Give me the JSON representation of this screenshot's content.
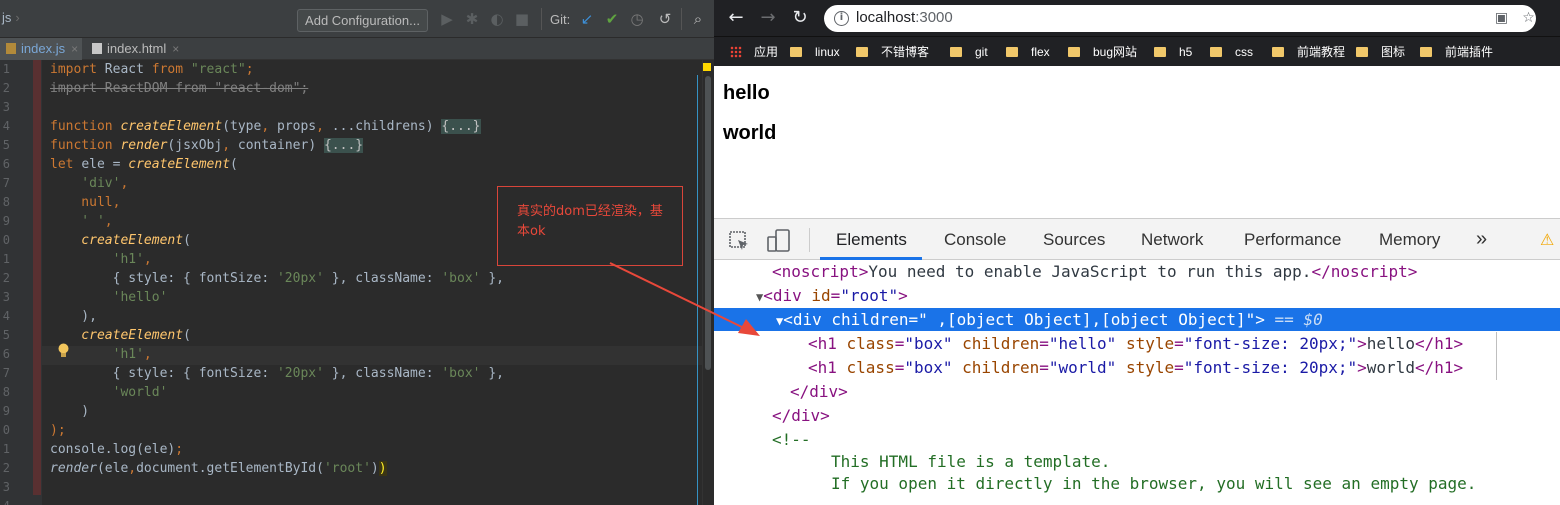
{
  "ide": {
    "breadcrumb": "js",
    "toolbar": {
      "add_configuration": "Add Configuration...",
      "git_label": "Git:"
    },
    "tabs": [
      {
        "label": "index.js",
        "active": true
      },
      {
        "label": "index.html",
        "active": false
      }
    ],
    "line_numbers": [
      "1",
      "2",
      "3",
      "4",
      "5",
      "6",
      "7",
      "8",
      "9",
      "0",
      "1",
      "2",
      "3",
      "4",
      "5",
      "6",
      "7",
      "8",
      "9",
      "0",
      "1",
      "2",
      "3",
      "4"
    ],
    "code_lines": [
      [
        {
          "t": "import ",
          "c": "kw"
        },
        {
          "t": "React ",
          "c": ""
        },
        {
          "t": "from ",
          "c": "kw"
        },
        {
          "t": "\"react\"",
          "c": "str"
        },
        {
          "t": ";",
          "c": "kw"
        }
      ],
      [
        {
          "t": "import ReactDOM from \"react-dom\";",
          "c": "dim"
        }
      ],
      [],
      [
        {
          "t": "function ",
          "c": "kw"
        },
        {
          "t": "createElement",
          "c": "fn"
        },
        {
          "t": "(type",
          "c": ""
        },
        {
          "t": ", ",
          "c": "kw"
        },
        {
          "t": "props",
          "c": ""
        },
        {
          "t": ", ",
          "c": "kw"
        },
        {
          "t": "...childrens) ",
          "c": ""
        },
        {
          "t": "{...}",
          "c": "fold"
        }
      ],
      [
        {
          "t": "function ",
          "c": "kw"
        },
        {
          "t": "render",
          "c": "fn"
        },
        {
          "t": "(jsxObj",
          "c": ""
        },
        {
          "t": ", ",
          "c": "kw"
        },
        {
          "t": "container) ",
          "c": ""
        },
        {
          "t": "{...}",
          "c": "fold"
        }
      ],
      [
        {
          "t": "let ",
          "c": "kw"
        },
        {
          "t": "ele = ",
          "c": ""
        },
        {
          "t": "createElement",
          "c": "fn"
        },
        {
          "t": "(",
          "c": ""
        }
      ],
      [
        {
          "t": "    'div'",
          "c": "str"
        },
        {
          "t": ",",
          "c": "kw"
        }
      ],
      [
        {
          "t": "    null",
          "c": "kw"
        },
        {
          "t": ",",
          "c": "kw"
        }
      ],
      [
        {
          "t": "    ' '",
          "c": "str"
        },
        {
          "t": ",",
          "c": "kw"
        }
      ],
      [
        {
          "t": "    createElement",
          "c": "fn"
        },
        {
          "t": "(",
          "c": ""
        }
      ],
      [
        {
          "t": "        'h1'",
          "c": "str"
        },
        {
          "t": ",",
          "c": "kw"
        }
      ],
      [
        {
          "t": "        { style: { fontSize: ",
          "c": ""
        },
        {
          "t": "'20px'",
          "c": "str"
        },
        {
          "t": " }, className: ",
          "c": ""
        },
        {
          "t": "'box'",
          "c": "str"
        },
        {
          "t": " },",
          "c": ""
        }
      ],
      [
        {
          "t": "        'hello'",
          "c": "str"
        }
      ],
      [
        {
          "t": "    ),",
          "c": ""
        }
      ],
      [
        {
          "t": "    createElement",
          "c": "fn"
        },
        {
          "t": "(",
          "c": ""
        }
      ],
      [
        {
          "t": "        'h1'",
          "c": "str"
        },
        {
          "t": ",",
          "c": "kw"
        }
      ],
      [
        {
          "t": "        { style: { fontSize: ",
          "c": ""
        },
        {
          "t": "'20px'",
          "c": "str"
        },
        {
          "t": " }, className: ",
          "c": ""
        },
        {
          "t": "'box'",
          "c": "str"
        },
        {
          "t": " },",
          "c": ""
        }
      ],
      [
        {
          "t": "        'world'",
          "c": "str"
        }
      ],
      [
        {
          "t": "    )",
          "c": ""
        }
      ],
      [
        {
          "t": ");",
          "c": "kw"
        }
      ],
      [
        {
          "t": "console.log(ele)",
          "c": ""
        },
        {
          "t": ";",
          "c": "kw"
        }
      ],
      [
        {
          "t": "render",
          "c": "fni"
        },
        {
          "t": "(ele",
          "c": ""
        },
        {
          "t": ",",
          "c": "kw"
        },
        {
          "t": "document.getElementById(",
          "c": ""
        },
        {
          "t": "'root'",
          "c": "str"
        },
        {
          "t": ")",
          "c": ""
        },
        {
          "t": ")",
          "c": "brk"
        }
      ],
      [],
      []
    ],
    "annotation": "真实的dom已经渲染，基本ok"
  },
  "browser": {
    "url_host": "localhost",
    "url_port": ":3000",
    "bookmarks": [
      {
        "label": "应用",
        "kind": "apps"
      },
      {
        "label": "linux",
        "kind": "folder"
      },
      {
        "label": "不错博客",
        "kind": "folder"
      },
      {
        "label": "git",
        "kind": "folder"
      },
      {
        "label": "flex",
        "kind": "folder"
      },
      {
        "label": "bug网站",
        "kind": "folder"
      },
      {
        "label": "h5",
        "kind": "folder"
      },
      {
        "label": "css",
        "kind": "folder"
      },
      {
        "label": "前端教程",
        "kind": "folder"
      },
      {
        "label": "图标",
        "kind": "folder"
      },
      {
        "label": "前端插件",
        "kind": "folder"
      }
    ],
    "page": {
      "h1_hello": "hello",
      "h1_world": "world"
    },
    "devtools": {
      "tabs": [
        "Elements",
        "Console",
        "Sources",
        "Network",
        "Performance",
        "Memory"
      ],
      "more": "»",
      "dom": {
        "noscript_open": "<noscript>",
        "noscript_text": "You need to enable JavaScript to run this app.",
        "noscript_close": "</noscript>",
        "root_tag": "<div ",
        "root_attr": "id",
        "root_val": "\"root\"",
        "sel_tag": "<div ",
        "sel_attr": "children",
        "sel_val": "\" ,[object Object],[object Object]\"",
        "sel_end": ">",
        "sel_eq": " == $0",
        "h1_tag": "<h1 ",
        "class_attr": "class",
        "class_val": "\"box\"",
        "children_attr": "children",
        "hello_val": "\"hello\"",
        "world_val": "\"world\"",
        "style_attr": "style",
        "style_val": "\"font-size: 20px;\"",
        "hello_text": "hello",
        "world_text": "world",
        "h1_close": "</h1>",
        "div_close": "</div>",
        "comment_open": "<!--",
        "comment_1": "This HTML file is a template.",
        "comment_2": "If you open it directly in the browser, you will see an empty page."
      }
    }
  },
  "colors": {
    "ide_bg": "#2b2b2b",
    "keyword": "#cc7832",
    "string": "#6a8759",
    "function": "#ffc66d",
    "selection_blue": "#1a73e8",
    "annotation_red": "#e8483a"
  }
}
